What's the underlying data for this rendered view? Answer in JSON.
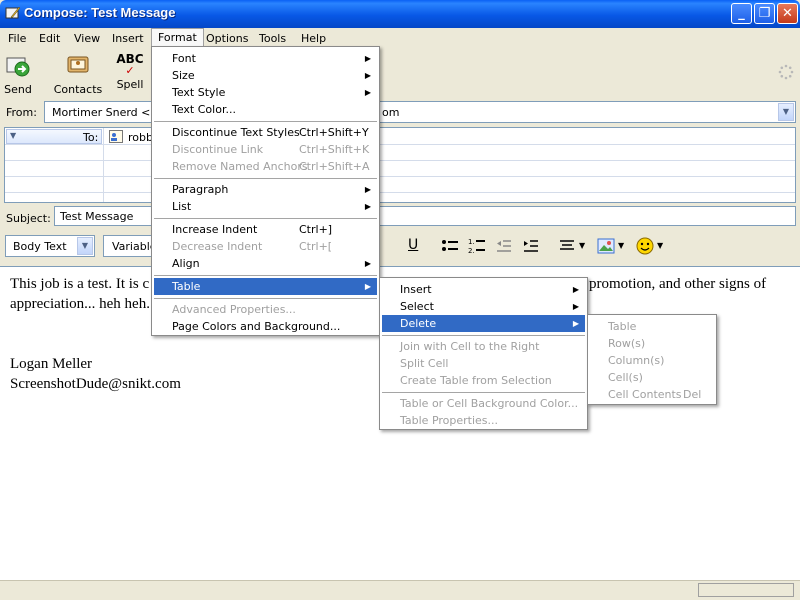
{
  "window": {
    "title": "Compose: Test Message"
  },
  "menubar": [
    "File",
    "Edit",
    "View",
    "Insert",
    "Format",
    "Options",
    "Tools",
    "Help"
  ],
  "toolbar": {
    "send": "Send",
    "contacts": "Contacts",
    "spell": "Spell",
    "spell_icon_text": "ABC"
  },
  "from": {
    "label": "From:",
    "value": "Mortimer Snerd <use",
    "tail": "om"
  },
  "to": {
    "label": "To:",
    "value": "robb"
  },
  "subject": {
    "label": "Subject:",
    "value": "Test Message"
  },
  "format_bar": {
    "style": "Body Text",
    "font": "Variable",
    "underline": "U"
  },
  "body": {
    "line1_left": "This job is a test.  It is c",
    "line1_right": "promotion, and other signs of",
    "line2": "appreciation... heh heh.",
    "sig_name": "Logan Meller",
    "sig_email": "ScreenshotDude@snikt.com"
  },
  "format_menu": {
    "font": "Font",
    "size": "Size",
    "text_style": "Text Style",
    "text_color": "Text Color...",
    "discontinue_text_styles": "Discontinue Text Styles",
    "discontinue_text_styles_sc": "Ctrl+Shift+Y",
    "discontinue_link": "Discontinue Link",
    "discontinue_link_sc": "Ctrl+Shift+K",
    "remove_anchors": "Remove Named Anchors",
    "remove_anchors_sc": "Ctrl+Shift+A",
    "paragraph": "Paragraph",
    "list": "List",
    "increase_indent": "Increase Indent",
    "increase_indent_sc": "Ctrl+]",
    "decrease_indent": "Decrease Indent",
    "decrease_indent_sc": "Ctrl+[",
    "align": "Align",
    "table": "Table",
    "advanced": "Advanced Properties...",
    "page_colors": "Page Colors and Background..."
  },
  "table_menu": {
    "insert": "Insert",
    "select": "Select",
    "delete": "Delete",
    "join": "Join with Cell to the Right",
    "split": "Split Cell",
    "create": "Create Table from Selection",
    "bg_color": "Table or Cell Background Color...",
    "properties": "Table Properties..."
  },
  "delete_menu": {
    "table": "Table",
    "rows": "Row(s)",
    "columns": "Column(s)",
    "cells": "Cell(s)",
    "contents": "Cell Contents",
    "contents_sc": "Del"
  },
  "colors": {
    "title_bar": "#0858e6",
    "highlight": "#316ac5",
    "disabled": "#a0a0a0"
  }
}
